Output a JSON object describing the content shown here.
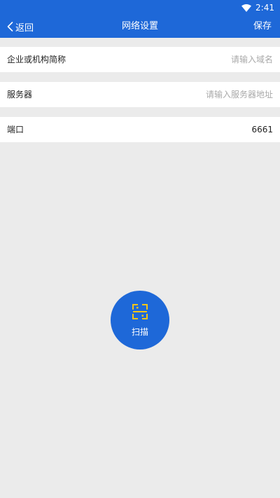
{
  "status_bar": {
    "time": "2:41",
    "icon": "wifi-icon"
  },
  "header": {
    "back_label": "返回",
    "back_icon": "chevron-left-icon",
    "title": "网络设置",
    "save_label": "保存"
  },
  "form": {
    "rows": [
      {
        "label": "企业或机构简称",
        "value": "",
        "placeholder": "请输入域名"
      },
      {
        "label": "服务器",
        "value": "",
        "placeholder": "请输入服务器地址"
      },
      {
        "label": "端口",
        "value": "6661",
        "placeholder": ""
      }
    ]
  },
  "scan": {
    "label": "扫描",
    "icon": "scan-qr-icon",
    "icon_color": "#f5c518"
  },
  "colors": {
    "primary": "#1e68d8",
    "background": "#ebebeb",
    "row_background": "#ffffff"
  }
}
